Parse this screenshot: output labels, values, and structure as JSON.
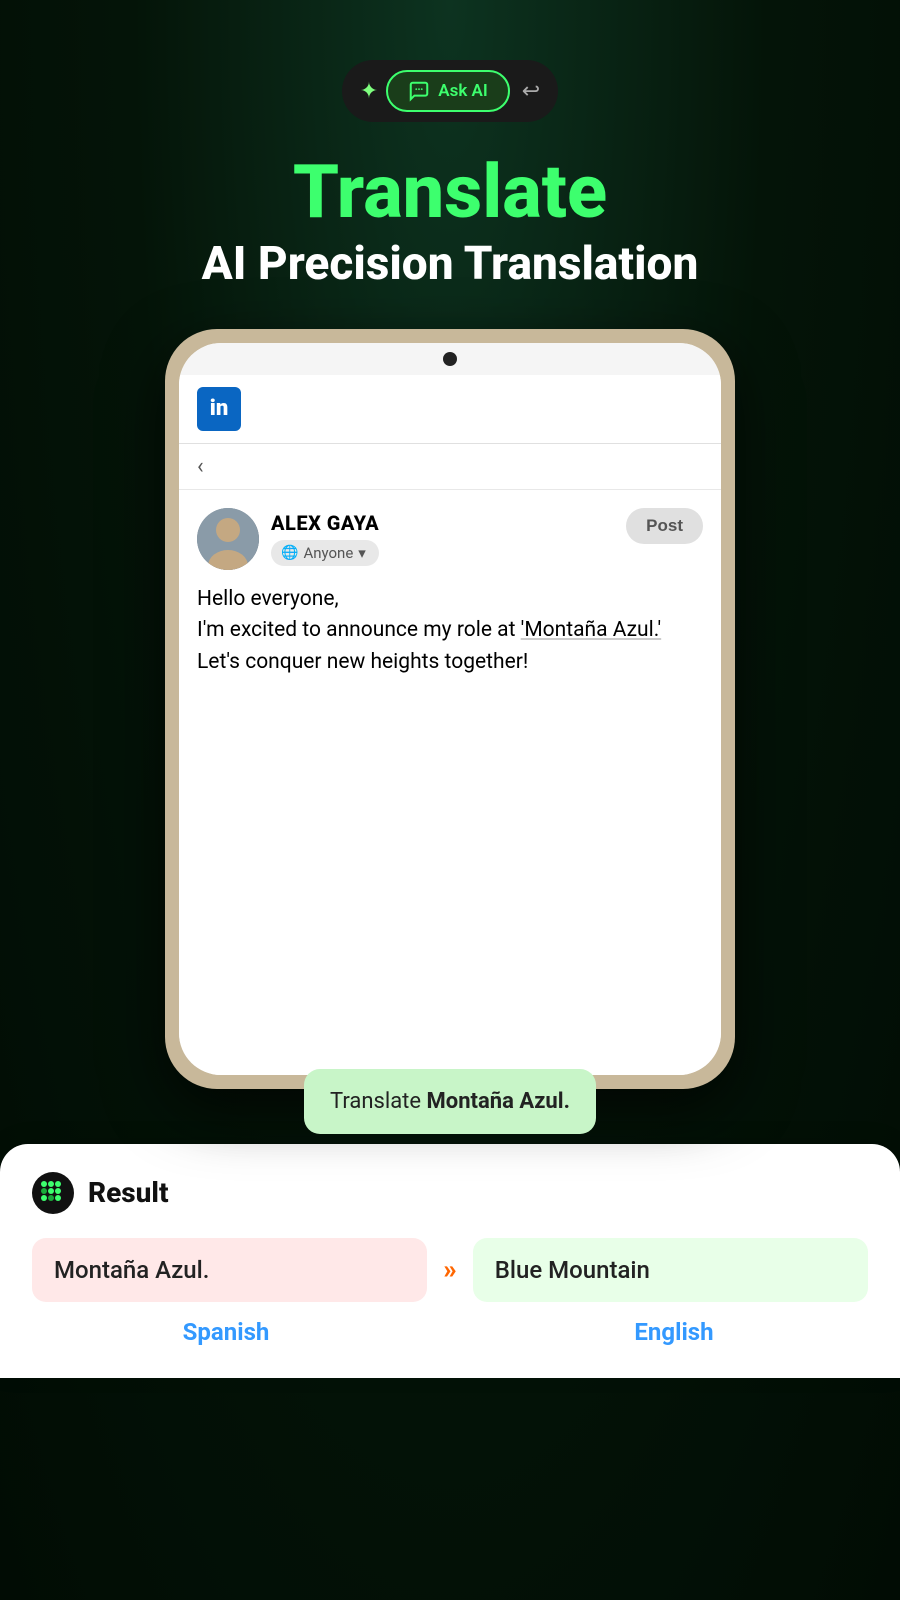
{
  "toolbar": {
    "ask_ai_label": "Ask AI"
  },
  "header": {
    "title": "Translate",
    "subtitle": "AI Precision Translation"
  },
  "linkedin": {
    "user_name": "ALEX GAYA",
    "audience": "Anyone",
    "post_btn": "Post",
    "post_text_1": "Hello everyone,",
    "post_text_2": "I'm excited to announce my role at ",
    "highlighted_word": "'Montaña Azul.'",
    "post_text_3": " Let's conquer new heights together!"
  },
  "translate_bubble": {
    "prefix": "Translate",
    "word": "Montaña Azul."
  },
  "result": {
    "title": "Result",
    "source_text": "Montaña Azul.",
    "target_text": "Blue Mountain",
    "source_lang": "Spanish",
    "target_lang": "English"
  }
}
